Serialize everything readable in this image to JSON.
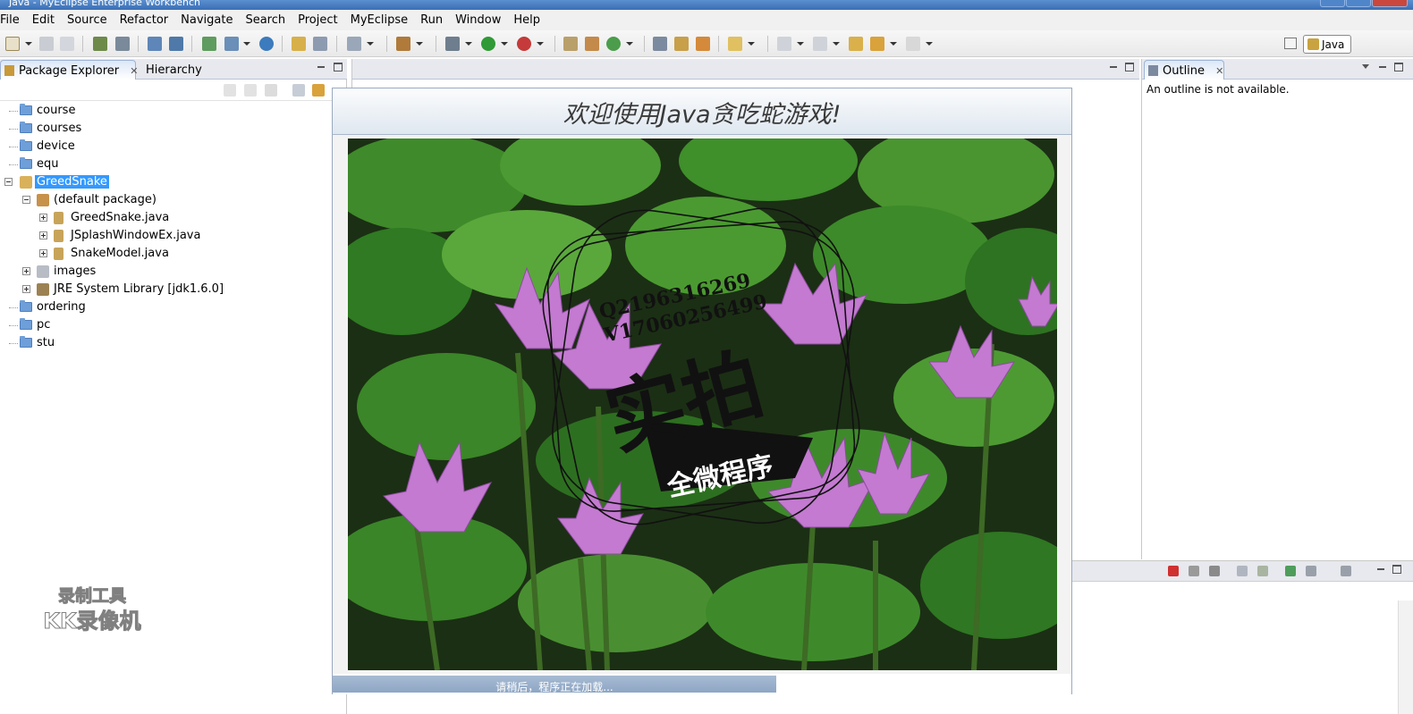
{
  "window": {
    "title": "Java - MyEclipse Enterprise Workbench"
  },
  "menu": [
    "File",
    "Edit",
    "Source",
    "Refactor",
    "Navigate",
    "Search",
    "Project",
    "MyEclipse",
    "Run",
    "Window",
    "Help"
  ],
  "perspective": {
    "java_label": "Java"
  },
  "left_tabs": {
    "package_explorer": "Package Explorer",
    "hierarchy": "Hierarchy",
    "close_glyph": "✕"
  },
  "tree": {
    "items": [
      {
        "label": "course"
      },
      {
        "label": "courses"
      },
      {
        "label": "device"
      },
      {
        "label": "equ"
      },
      {
        "label": "GreedSnake"
      },
      {
        "label": "(default package)"
      },
      {
        "label": "GreedSnake.java"
      },
      {
        "label": "JSplashWindowEx.java"
      },
      {
        "label": "SnakeModel.java"
      },
      {
        "label": "images"
      },
      {
        "label": "JRE System Library [jdk1.6.0]"
      },
      {
        "label": "ordering"
      },
      {
        "label": "pc"
      },
      {
        "label": "stu"
      }
    ]
  },
  "outline": {
    "tab": "Outline",
    "close_glyph": "✕",
    "message": "An outline is not available."
  },
  "splash": {
    "title": "欢迎使用Java贪吃蛇游戏!",
    "status": "请稍后，程序正在加载...",
    "progress_fraction": 0.6
  },
  "stamp": {
    "id1": "Q2196316269",
    "id2": "V17060256499",
    "big": "实拍",
    "sub": "全微程序"
  },
  "recorder_watermark": {
    "line1": "录制工具",
    "line2": "KK录像机"
  },
  "colors": {
    "selection": "#3399ff",
    "folder": "#6f9fd8",
    "progress": "#8ea6c4",
    "titlebar": "#3b6fb4"
  }
}
